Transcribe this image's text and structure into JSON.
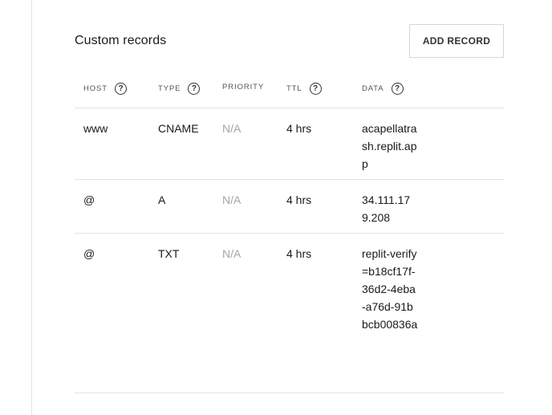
{
  "panel": {
    "title": "Custom records",
    "add_button_label": "ADD RECORD"
  },
  "table": {
    "columns": [
      {
        "label": "HOST",
        "help": true
      },
      {
        "label": "TYPE",
        "help": true
      },
      {
        "label": "PRIORITY",
        "help": false
      },
      {
        "label": "TTL",
        "help": true
      },
      {
        "label": "DATA",
        "help": true
      }
    ],
    "rows": [
      {
        "host": "www",
        "type": "CNAME",
        "priority": "N/A",
        "ttl": "4 hrs",
        "data": "acapellatrash.replit.app"
      },
      {
        "host": "@",
        "type": "A",
        "priority": "N/A",
        "ttl": "4 hrs",
        "data": "34.111.179.208"
      },
      {
        "host": "@",
        "type": "TXT",
        "priority": "N/A",
        "ttl": "4 hrs",
        "data": "replit-verify=b18cf17f-36d2-4eba-a76d-91bbcb00836a"
      }
    ]
  },
  "icons": {
    "help": "question-circle-icon"
  },
  "help_glyph": "?"
}
